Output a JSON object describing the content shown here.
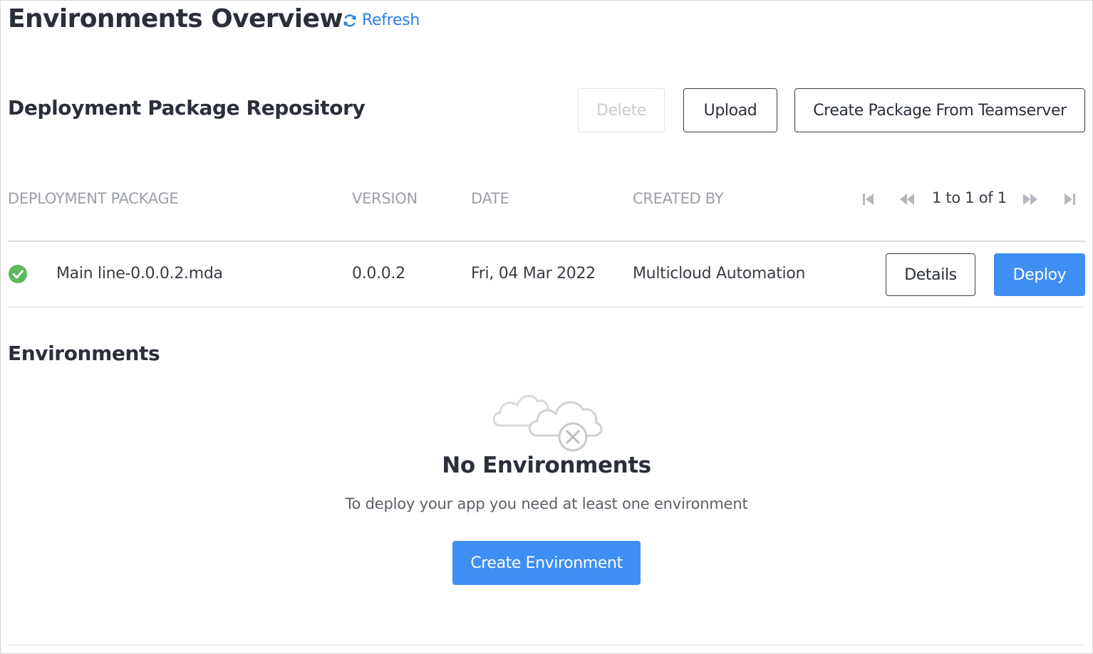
{
  "header": {
    "title": "Environments Overview",
    "refresh_label": "Refresh",
    "refresh_icon": "refresh-icon"
  },
  "repository": {
    "title": "Deployment Package Repository",
    "buttons": {
      "delete_label": "Delete",
      "upload_label": "Upload",
      "create_package_label": "Create Package From Teamserver"
    },
    "columns": [
      "DEPLOYMENT PACKAGE",
      "VERSION",
      "DATE",
      "CREATED BY"
    ],
    "pagination": {
      "text": "1 to 1 of 1",
      "icons": [
        "first-page-icon",
        "previous-page-icon",
        "next-page-icon",
        "last-page-icon"
      ]
    },
    "rows": [
      {
        "status_icon": "check-circle-icon",
        "package": "Main line-0.0.0.2.mda",
        "version": "0.0.0.2",
        "date": "Fri, 04 Mar 2022",
        "created_by": "Multicloud Automation",
        "details_label": "Details",
        "deploy_label": "Deploy"
      }
    ]
  },
  "environments": {
    "title": "Environments",
    "empty_icon": "cloud-error-icon",
    "empty_title": "No Environments",
    "empty_message": "To deploy your app you need at least one environment",
    "create_label": "Create Environment"
  },
  "colors": {
    "accent": "#3f8ef3",
    "link": "#2d7dea",
    "success": "#5cb85c",
    "text": "#2a2f3a",
    "muted": "#9b9fa6"
  }
}
